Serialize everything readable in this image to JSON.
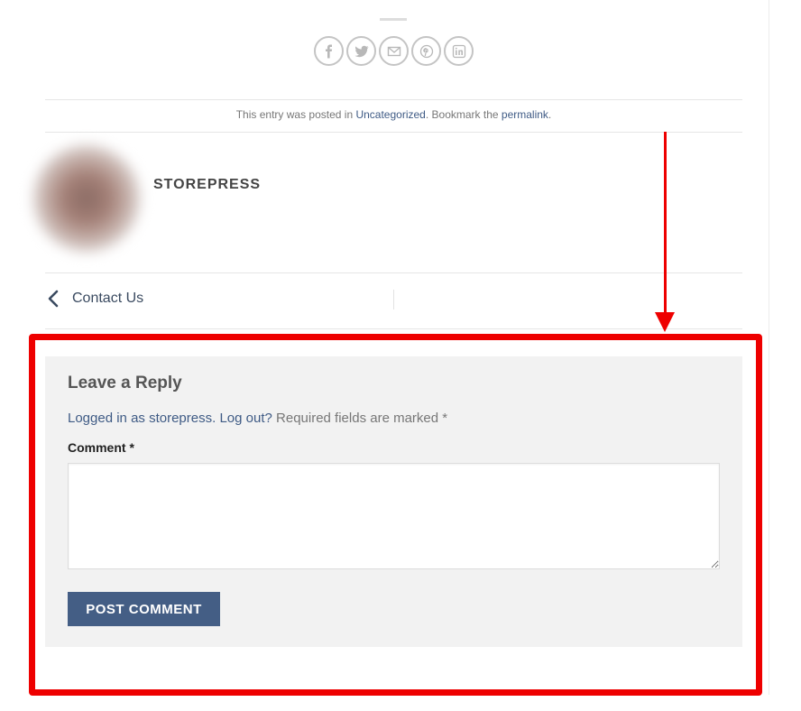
{
  "share": {
    "icons": [
      "facebook-icon",
      "twitter-icon",
      "email-icon",
      "pinterest-icon",
      "linkedin-icon"
    ]
  },
  "entry_meta": {
    "prefix": "This entry was posted in ",
    "category_link": "Uncategorized",
    "middle": ". Bookmark the ",
    "permalink_link": "permalink",
    "suffix": "."
  },
  "author": {
    "name": "STOREPRESS"
  },
  "post_nav": {
    "previous_label": "Contact Us"
  },
  "reply": {
    "title": "Leave a Reply",
    "logged_in_link": "Logged in as storepress.",
    "logout_link": "Log out?",
    "required_note": "Required fields are marked *",
    "comment_label": "Comment *",
    "comment_value": "",
    "submit_label": "POST COMMENT"
  },
  "colors": {
    "link": "#3f5b85",
    "button": "#445e85",
    "annotation": "#ee0000",
    "form_bg": "#f2f2f2"
  }
}
